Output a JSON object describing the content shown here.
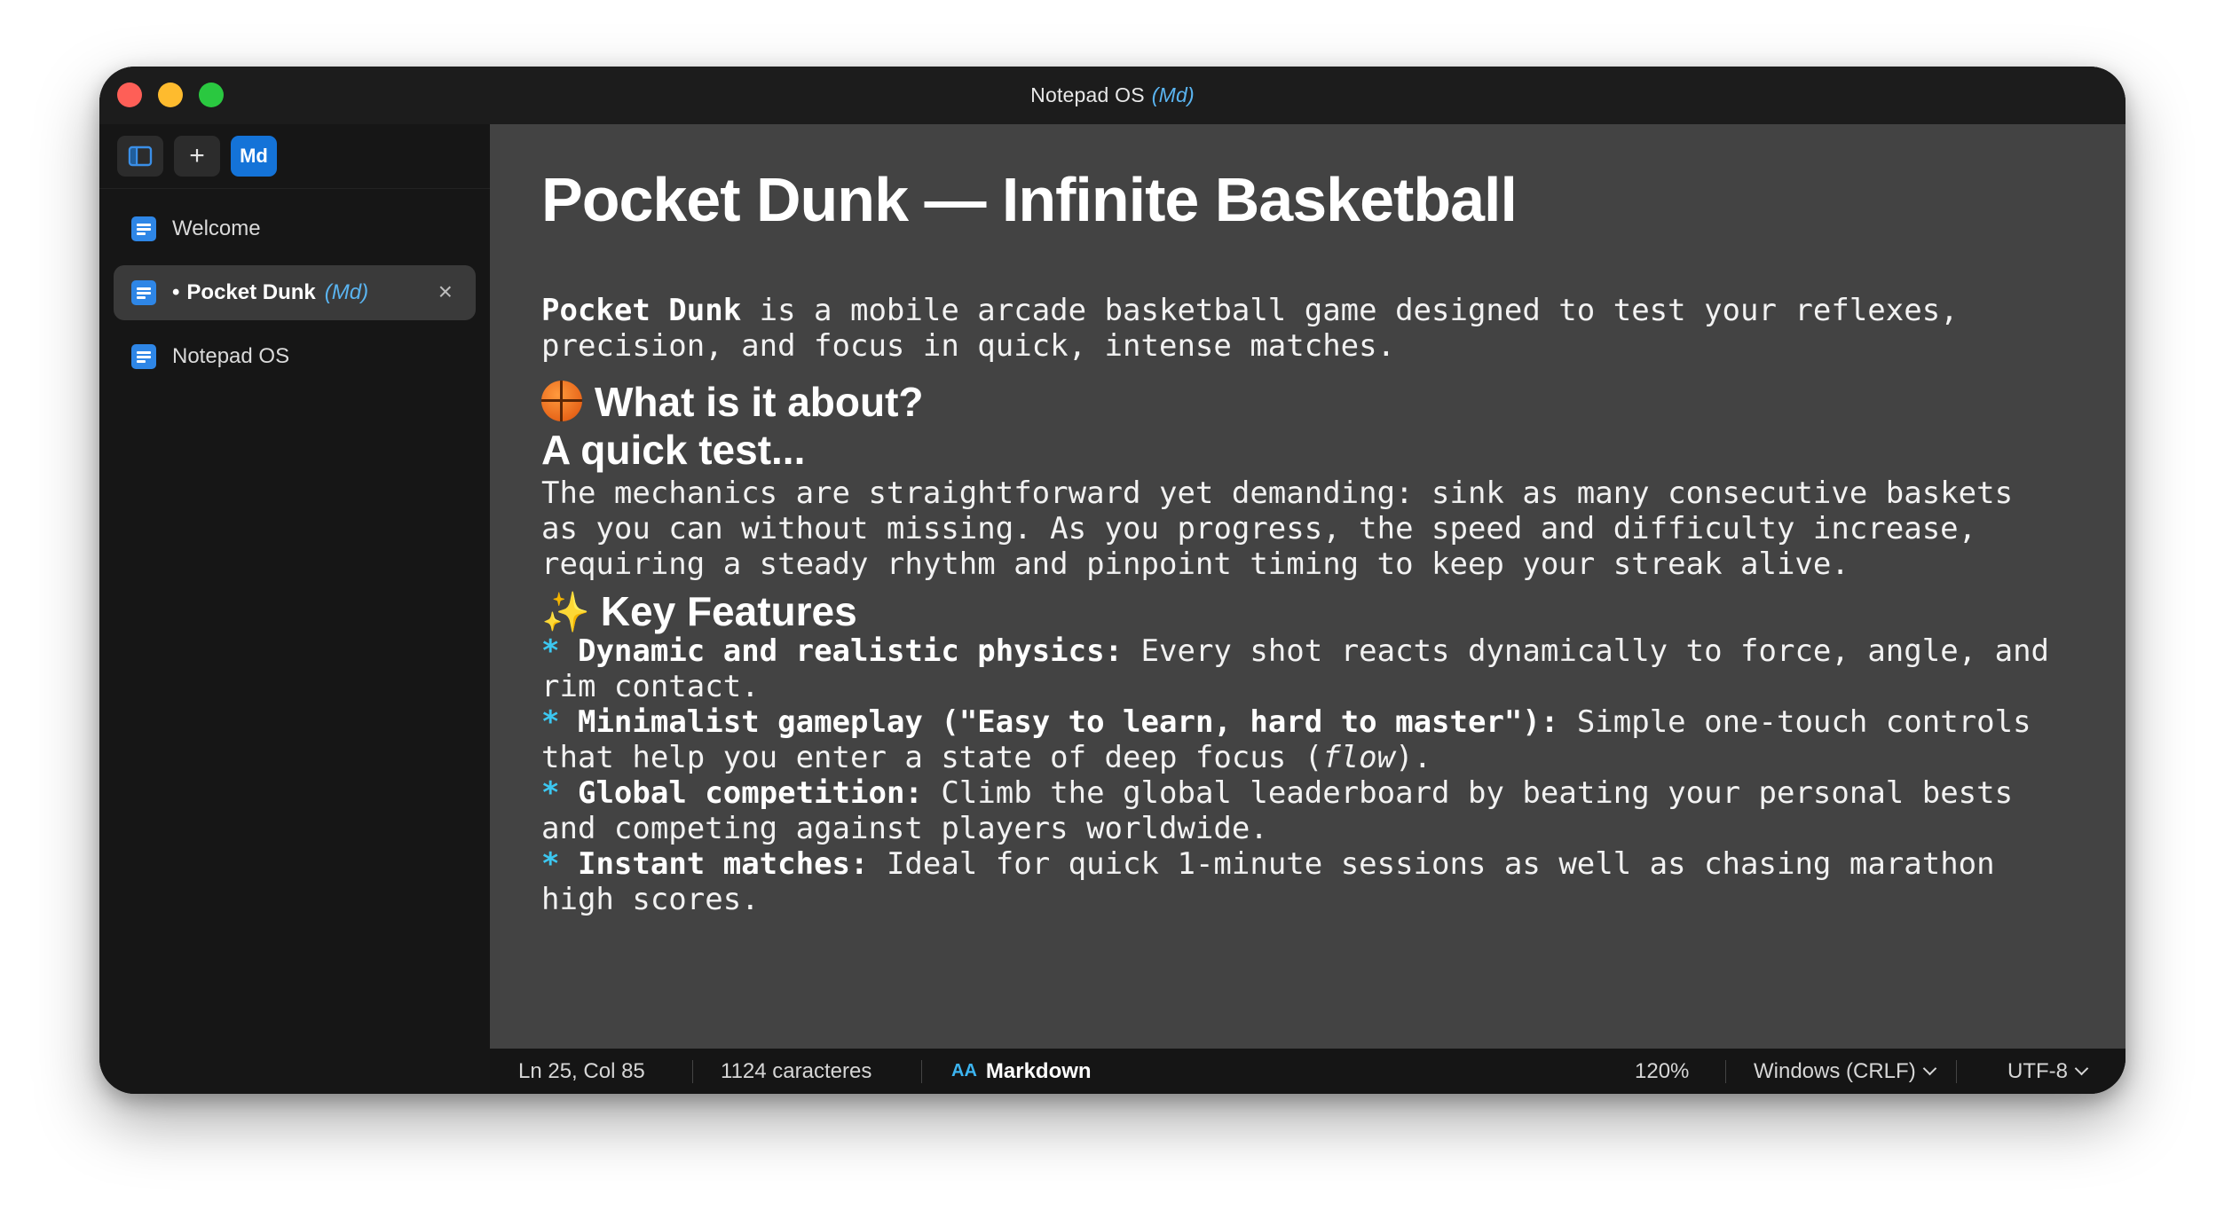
{
  "window": {
    "title": "Notepad OS",
    "title_mode": "(Md)"
  },
  "toolbar": {
    "sidebar_toggle_icon": "sidebar-icon",
    "new_label": "+",
    "md_label": "Md"
  },
  "sidebar": {
    "items": [
      {
        "label": "Welcome",
        "icon": "document-icon"
      },
      {
        "label": "Pocket Dunk",
        "prefix": "•",
        "mode": "(Md)",
        "icon": "document-icon",
        "active": true,
        "close": "×"
      },
      {
        "label": "Notepad OS",
        "icon": "document-icon"
      }
    ]
  },
  "document": {
    "title": "Pocket Dunk — Infinite Basketball",
    "intro_bold": "Pocket Dunk",
    "intro_line1_rest": " is a mobile arcade basketball game designed to test your reflexes,",
    "intro_line2": "precision, and focus in quick, intense matches.",
    "section1_heading": "What is it about?",
    "section1_subheading": "A quick test...",
    "section1_line1": "The mechanics are straightforward yet demanding: sink as many consecutive baskets",
    "section1_line2": "as you can without missing. As you progress, the speed and difficulty increase,",
    "section1_line3": "requiring a steady rhythm and pinpoint timing to keep your streak alive.",
    "section2_heading": "Key Features",
    "bullet_char": "*",
    "features": [
      {
        "title": "Dynamic and realistic physics:",
        "line1_rest": " Every shot reacts dynamically to force, angle, and",
        "line2": "rim contact."
      },
      {
        "title": "Minimalist gameplay (\"Easy to learn, hard to master\"):",
        "line1_rest": " Simple one-touch controls",
        "line2_pre": "that help you enter a state of deep focus (",
        "line2_italic": "flow",
        "line2_post": ")."
      },
      {
        "title": "Global competition:",
        "line1_rest": " Climb the global leaderboard by beating your personal bests",
        "line2": "and competing against players worldwide."
      },
      {
        "title": "Instant matches:",
        "line1_rest": " Ideal for quick 1-minute sessions as well as chasing marathon",
        "line2": "high scores."
      }
    ]
  },
  "statusbar": {
    "position": "Ln 25, Col 85",
    "chars": "1124 caracteres",
    "lang_prefix": "AA",
    "language": "Markdown",
    "zoom": "120%",
    "line_ending": "Windows (CRLF)",
    "encoding": "UTF-8"
  },
  "colors": {
    "accent": "#1473d8",
    "mode_text": "#5ab4f0",
    "bullet": "#3cc7f0",
    "editor_bg": "#434343",
    "sidebar_bg": "#161616"
  }
}
